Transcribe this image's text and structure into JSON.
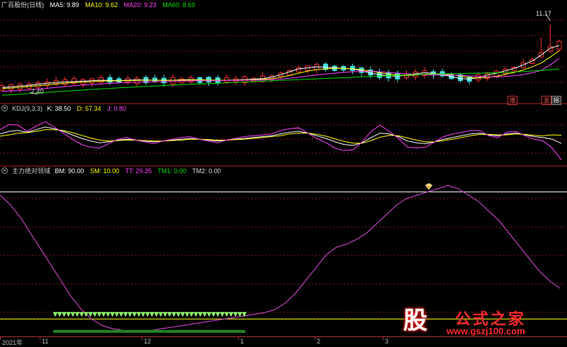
{
  "panels": {
    "main": {
      "stock_name": "广百股份(日线)",
      "indicators": [
        {
          "label": "MA5: 9.89",
          "color": "#ffffff"
        },
        {
          "label": "MA10: 9.62",
          "color": "#ffff00"
        },
        {
          "label": "MA20: 9.23",
          "color": "#ff40ff"
        },
        {
          "label": "MA60: 8.69",
          "color": "#00e000"
        }
      ],
      "high_label": "11.17",
      "low_label": "7.40",
      "badges": {
        "left": "增",
        "right_a": "涨",
        "right_b": "拐"
      }
    },
    "kdj": {
      "title": "KDJ(9,3,3)",
      "indicators": [
        {
          "label": "K: 38.50",
          "color": "#ffffff"
        },
        {
          "label": "D: 57.34",
          "color": "#ffff00"
        },
        {
          "label": "J: 0.80",
          "color": "#ff40ff"
        }
      ]
    },
    "custom": {
      "title": "主力绝对领域",
      "indicators": [
        {
          "label": "BM: 90.00",
          "color": "#ffffff"
        },
        {
          "label": "SM: 10.00",
          "color": "#ffff00"
        },
        {
          "label": "TT: 29.35",
          "color": "#ff40ff"
        },
        {
          "label": "TM1: 0.00",
          "color": "#00e000"
        },
        {
          "label": "TM2: 0.00",
          "color": "#dddddd"
        }
      ]
    }
  },
  "x_axis": {
    "labels": [
      {
        "text": "2021年",
        "frac": 0.0
      },
      {
        "text": "11",
        "frac": 0.07
      },
      {
        "text": "12",
        "frac": 0.25
      },
      {
        "text": "1",
        "frac": 0.42
      },
      {
        "text": "2",
        "frac": 0.555
      },
      {
        "text": "3",
        "frac": 0.675
      }
    ]
  },
  "colors": {
    "up": "#ff3030",
    "down": "#40e0e0",
    "ma5": "#ffffff",
    "ma10": "#ffff00",
    "ma20": "#ff40ff",
    "ma60": "#00e000",
    "grid": "#8a1515",
    "separator": "#b02020",
    "tt": "#c040c0",
    "signal": "#80ff60"
  },
  "chart_data": [
    {
      "type": "candlestick",
      "title": "广百股份(日线)",
      "price_range": [
        7.0,
        11.7
      ],
      "series": [
        {
          "name": "MA5",
          "values": [
            7.75,
            7.78,
            7.82,
            7.86,
            7.92,
            7.96,
            8.0,
            8.03,
            8.05,
            8.07,
            8.1,
            8.12,
            8.11,
            8.1,
            8.12,
            8.14,
            8.13,
            8.12,
            8.11,
            8.12,
            8.14,
            8.15,
            8.14,
            8.12,
            8.11,
            8.12,
            8.13,
            8.15,
            8.17,
            8.2,
            8.28,
            8.4,
            8.55,
            8.7,
            8.75,
            8.8,
            8.78,
            8.75,
            8.72,
            8.7,
            8.6,
            8.48,
            8.4,
            8.35,
            8.33,
            8.38,
            8.45,
            8.5,
            8.47,
            8.4,
            8.3,
            8.2,
            8.18,
            8.25,
            8.38,
            8.48,
            8.6,
            8.72,
            8.9,
            9.1,
            9.4,
            9.75,
            9.89
          ]
        },
        {
          "name": "MA10",
          "values": [
            7.7,
            7.72,
            7.76,
            7.8,
            7.84,
            7.88,
            7.93,
            7.96,
            8.0,
            8.02,
            8.05,
            8.07,
            8.08,
            8.09,
            8.1,
            8.11,
            8.12,
            8.12,
            8.12,
            8.12,
            8.12,
            8.13,
            8.13,
            8.13,
            8.12,
            8.12,
            8.12,
            8.13,
            8.14,
            8.16,
            8.2,
            8.27,
            8.36,
            8.48,
            8.58,
            8.66,
            8.7,
            8.72,
            8.72,
            8.7,
            8.66,
            8.58,
            8.5,
            8.43,
            8.38,
            8.36,
            8.38,
            8.42,
            8.45,
            8.44,
            8.4,
            8.33,
            8.26,
            8.23,
            8.26,
            8.32,
            8.42,
            8.52,
            8.64,
            8.8,
            9.0,
            9.3,
            9.62
          ]
        },
        {
          "name": "MA20",
          "values": [
            7.55,
            7.57,
            7.6,
            7.63,
            7.67,
            7.71,
            7.75,
            7.79,
            7.83,
            7.87,
            7.9,
            7.93,
            7.96,
            7.98,
            8.0,
            8.02,
            8.04,
            8.05,
            8.06,
            8.07,
            8.08,
            8.09,
            8.1,
            8.1,
            8.1,
            8.11,
            8.11,
            8.12,
            8.12,
            8.13,
            8.15,
            8.18,
            8.22,
            8.27,
            8.33,
            8.39,
            8.44,
            8.48,
            8.52,
            8.55,
            8.57,
            8.57,
            8.55,
            8.52,
            8.48,
            8.45,
            8.42,
            8.4,
            8.39,
            8.39,
            8.38,
            8.36,
            8.34,
            8.31,
            8.29,
            8.29,
            8.31,
            8.35,
            8.41,
            8.5,
            8.62,
            8.9,
            9.23
          ]
        },
        {
          "name": "MA60",
          "values": [
            7.35,
            7.38,
            7.41,
            7.44,
            7.47,
            7.5,
            7.53,
            7.56,
            7.59,
            7.62,
            7.65,
            7.68,
            7.7,
            7.73,
            7.75,
            7.78,
            7.8,
            7.82,
            7.85,
            7.87,
            7.89,
            7.91,
            7.93,
            7.95,
            7.97,
            7.99,
            8.01,
            8.03,
            8.05,
            8.07,
            8.09,
            8.11,
            8.13,
            8.15,
            8.17,
            8.19,
            8.21,
            8.23,
            8.25,
            8.27,
            8.29,
            8.31,
            8.33,
            8.35,
            8.37,
            8.39,
            8.41,
            8.42,
            8.43,
            8.44,
            8.45,
            8.46,
            8.47,
            8.48,
            8.49,
            8.5,
            8.52,
            8.54,
            8.56,
            8.59,
            8.62,
            8.66,
            8.69
          ]
        }
      ]
    },
    {
      "type": "line",
      "title": "KDJ(9,3,3)",
      "ylim": [
        -10,
        110
      ],
      "series": [
        {
          "name": "K",
          "values": [
            60,
            66,
            68,
            64,
            70,
            76,
            72,
            66,
            58,
            50,
            44,
            40,
            42,
            46,
            48,
            46,
            44,
            42,
            44,
            46,
            48,
            50,
            48,
            46,
            44,
            46,
            48,
            50,
            52,
            54,
            56,
            60,
            64,
            66,
            62,
            56,
            50,
            42,
            36,
            34,
            40,
            52,
            62,
            60,
            54,
            44,
            40,
            38,
            42,
            48,
            52,
            56,
            60,
            62,
            58,
            56,
            60,
            62,
            58,
            54,
            52,
            48,
            38.5
          ]
        },
        {
          "name": "D",
          "values": [
            55,
            58,
            62,
            63,
            66,
            70,
            70,
            68,
            63,
            57,
            51,
            46,
            44,
            45,
            46,
            46,
            45,
            44,
            44,
            45,
            46,
            48,
            48,
            47,
            46,
            46,
            47,
            48,
            50,
            52,
            54,
            56,
            60,
            62,
            62,
            59,
            55,
            49,
            43,
            39,
            39,
            45,
            53,
            57,
            56,
            51,
            46,
            42,
            42,
            45,
            48,
            52,
            56,
            59,
            59,
            58,
            58,
            60,
            59,
            57,
            56,
            58,
            57.34
          ]
        },
        {
          "name": "J",
          "values": [
            70,
            82,
            80,
            66,
            78,
            88,
            76,
            62,
            48,
            36,
            30,
            28,
            38,
            48,
            52,
            46,
            42,
            38,
            44,
            48,
            52,
            54,
            48,
            44,
            40,
            46,
            50,
            54,
            56,
            58,
            60,
            68,
            72,
            74,
            62,
            50,
            40,
            28,
            22,
            24,
            42,
            66,
            80,
            66,
            50,
            30,
            28,
            30,
            42,
            54,
            60,
            64,
            68,
            68,
            56,
            52,
            64,
            66,
            56,
            48,
            44,
            28,
            0.8
          ]
        }
      ]
    },
    {
      "type": "line",
      "title": "主力绝对领域",
      "ylim": [
        0,
        100
      ],
      "reference_lines": [
        {
          "name": "BM",
          "value": 90
        },
        {
          "name": "SM",
          "value": 10
        }
      ],
      "series": [
        {
          "name": "TT",
          "values": [
            88,
            82,
            74,
            64,
            54,
            44,
            34,
            24,
            16,
            10,
            6,
            4,
            3,
            2,
            2,
            3,
            4,
            5,
            6,
            7,
            8,
            9,
            10,
            11,
            12,
            13,
            14,
            16,
            20,
            26,
            34,
            42,
            50,
            55,
            57,
            60,
            64,
            70,
            76,
            82,
            86,
            88,
            90,
            92,
            94,
            92,
            88,
            84,
            78,
            72,
            64,
            56,
            48,
            40,
            34,
            29.35
          ]
        },
        {
          "name": "TM1",
          "values": [
            0,
            0,
            0,
            0,
            0,
            0,
            0,
            0,
            0,
            0,
            0,
            0,
            0,
            0,
            0,
            0,
            0,
            0,
            0,
            0,
            0,
            0,
            0,
            0,
            0,
            0,
            0,
            0,
            0,
            0,
            0,
            0,
            0,
            0,
            0,
            0,
            0,
            0,
            0,
            0,
            0,
            0,
            0,
            0,
            0,
            0,
            0,
            0,
            0,
            0,
            0,
            0,
            0,
            0,
            0,
            0
          ]
        },
        {
          "name": "TM2",
          "values": [
            0,
            0,
            0,
            0,
            0,
            0,
            0,
            0,
            0,
            0,
            0,
            0,
            0,
            0,
            0,
            0,
            0,
            0,
            0,
            0,
            0,
            0,
            0,
            0,
            0,
            0,
            0,
            0,
            0,
            0,
            0,
            0,
            0,
            0,
            0,
            0,
            0,
            0,
            0,
            0,
            0,
            0,
            0,
            0,
            0,
            0,
            0,
            0,
            0,
            0,
            0,
            0,
            0,
            0,
            0,
            0
          ]
        }
      ]
    }
  ],
  "watermark": {
    "glyph": "股",
    "name": "公式之家",
    "url": "www.gszj100.com"
  }
}
